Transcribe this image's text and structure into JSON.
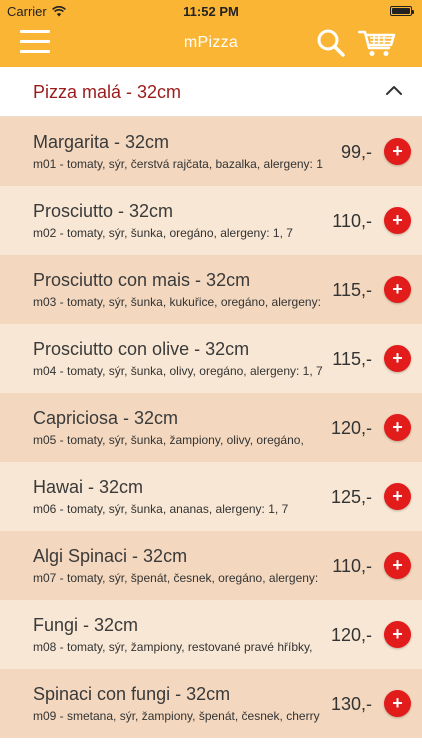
{
  "status": {
    "carrier": "Carrier",
    "time": "11:52 PM"
  },
  "header": {
    "title": "mPizza"
  },
  "icons": {
    "menu": "menu-icon",
    "search": "search-icon",
    "cart": "cart-icon",
    "collapse": "chevron-up-icon",
    "add": "plus-icon"
  },
  "colors": {
    "header": "#fbb534",
    "category_text": "#9b1b1b",
    "row_dark": "#f3d8bf",
    "row_light": "#f8e7d4",
    "add_button": "#e21b1b"
  },
  "category": {
    "title": "Pizza malá - 32cm"
  },
  "items": [
    {
      "name": "Margarita - 32cm",
      "desc": "m01 - tomaty, sýr, čerstvá rajčata, bazalka, alergeny: 1, 7",
      "price": "99,-",
      "add": "+"
    },
    {
      "name": "Prosciutto - 32cm",
      "desc": "m02 - tomaty, sýr, šunka, oregáno, alergeny: 1, 7",
      "price": "110,-",
      "add": "+"
    },
    {
      "name": "Prosciutto con mais - 32cm",
      "desc": "m03 - tomaty, sýr, šunka, kukuřice, oregáno, alergeny:",
      "price": "115,-",
      "add": "+"
    },
    {
      "name": "Prosciutto con olive - 32cm",
      "desc": "m04 - tomaty, sýr, šunka, olivy, oregáno, alergeny: 1, 7",
      "price": "115,-",
      "add": "+"
    },
    {
      "name": "Capriciosa - 32cm",
      "desc": "m05 - tomaty, sýr, šunka, žampiony, olivy, oregáno,",
      "price": "120,-",
      "add": "+"
    },
    {
      "name": "Hawai - 32cm",
      "desc": "m06 - tomaty, sýr, šunka, ananas, alergeny: 1, 7",
      "price": "125,-",
      "add": "+"
    },
    {
      "name": "Algi Spinaci - 32cm",
      "desc": "m07 - tomaty, sýr, špenát, česnek, oregáno, alergeny:",
      "price": "110,-",
      "add": "+"
    },
    {
      "name": "Fungi - 32cm",
      "desc": "m08 - tomaty, sýr, žampiony, restované pravé hříbky,",
      "price": "120,-",
      "add": "+"
    },
    {
      "name": "Spinaci con fungi - 32cm",
      "desc": "m09 - smetana, sýr, žampiony, špenát, česnek, cherry",
      "price": "130,-",
      "add": "+"
    }
  ]
}
